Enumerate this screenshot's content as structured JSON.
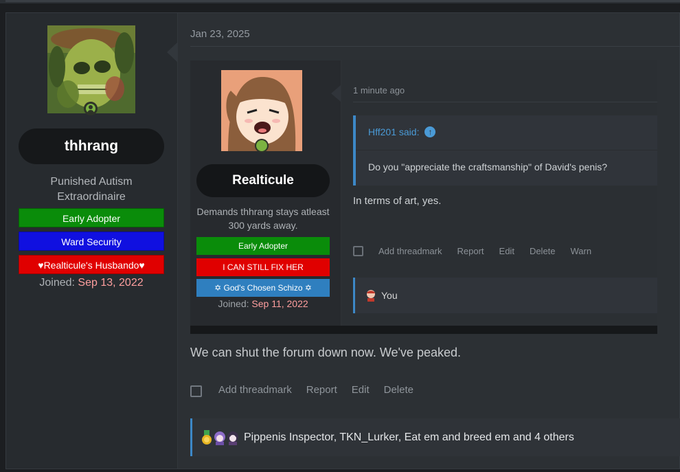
{
  "colors": {
    "accent": "#3c88c7",
    "joined_date": "#ff9f9f",
    "banner_green": "#0a8c0a",
    "banner_blue": "#1010e0",
    "banner_red": "#e00000",
    "banner_lightblue": "#2f7fbf"
  },
  "author": {
    "username": "thhrang",
    "title": "Punished Autism Extraordinaire",
    "banners": [
      "Early Adopter",
      "Ward Security",
      "♥Realticule's Husbando♥"
    ],
    "joined_label": "Joined:",
    "joined_date": "Sep 13, 2022",
    "avatar_icon": "camo-skull-avatar",
    "status_icon": "online-user-icon"
  },
  "post": {
    "date": "Jan 23, 2025",
    "message": "We can shut the forum down now. We've peaked.",
    "actions": [
      "Add threadmark",
      "Report",
      "Edit",
      "Delete"
    ]
  },
  "embedded": {
    "username": "Realticule",
    "title": "Demands thhrang stays atleast 300 yards away.",
    "banners": [
      "Early Adopter",
      "I CAN STILL FIX HER",
      "✡ God's Chosen Schizo ✡"
    ],
    "joined_label": "Joined:",
    "joined_date": "Sep 11, 2022",
    "time": "1 minute ago",
    "quote_author": "Hff201 said:",
    "quote_body": "Do you \"appreciate the craftsmanship\" of David's penis?",
    "message": "In terms of art, yes.",
    "actions": [
      "Add threadmark",
      "Report",
      "Edit",
      "Delete",
      "Warn"
    ],
    "reaction_text": "You"
  },
  "reactions": {
    "icons": [
      "medal-icon",
      "purple-anime-icon",
      "dark-anime-icon"
    ],
    "text": "Pippenis Inspector, TKN_Lurker, Eat em and breed em and 4 others"
  }
}
